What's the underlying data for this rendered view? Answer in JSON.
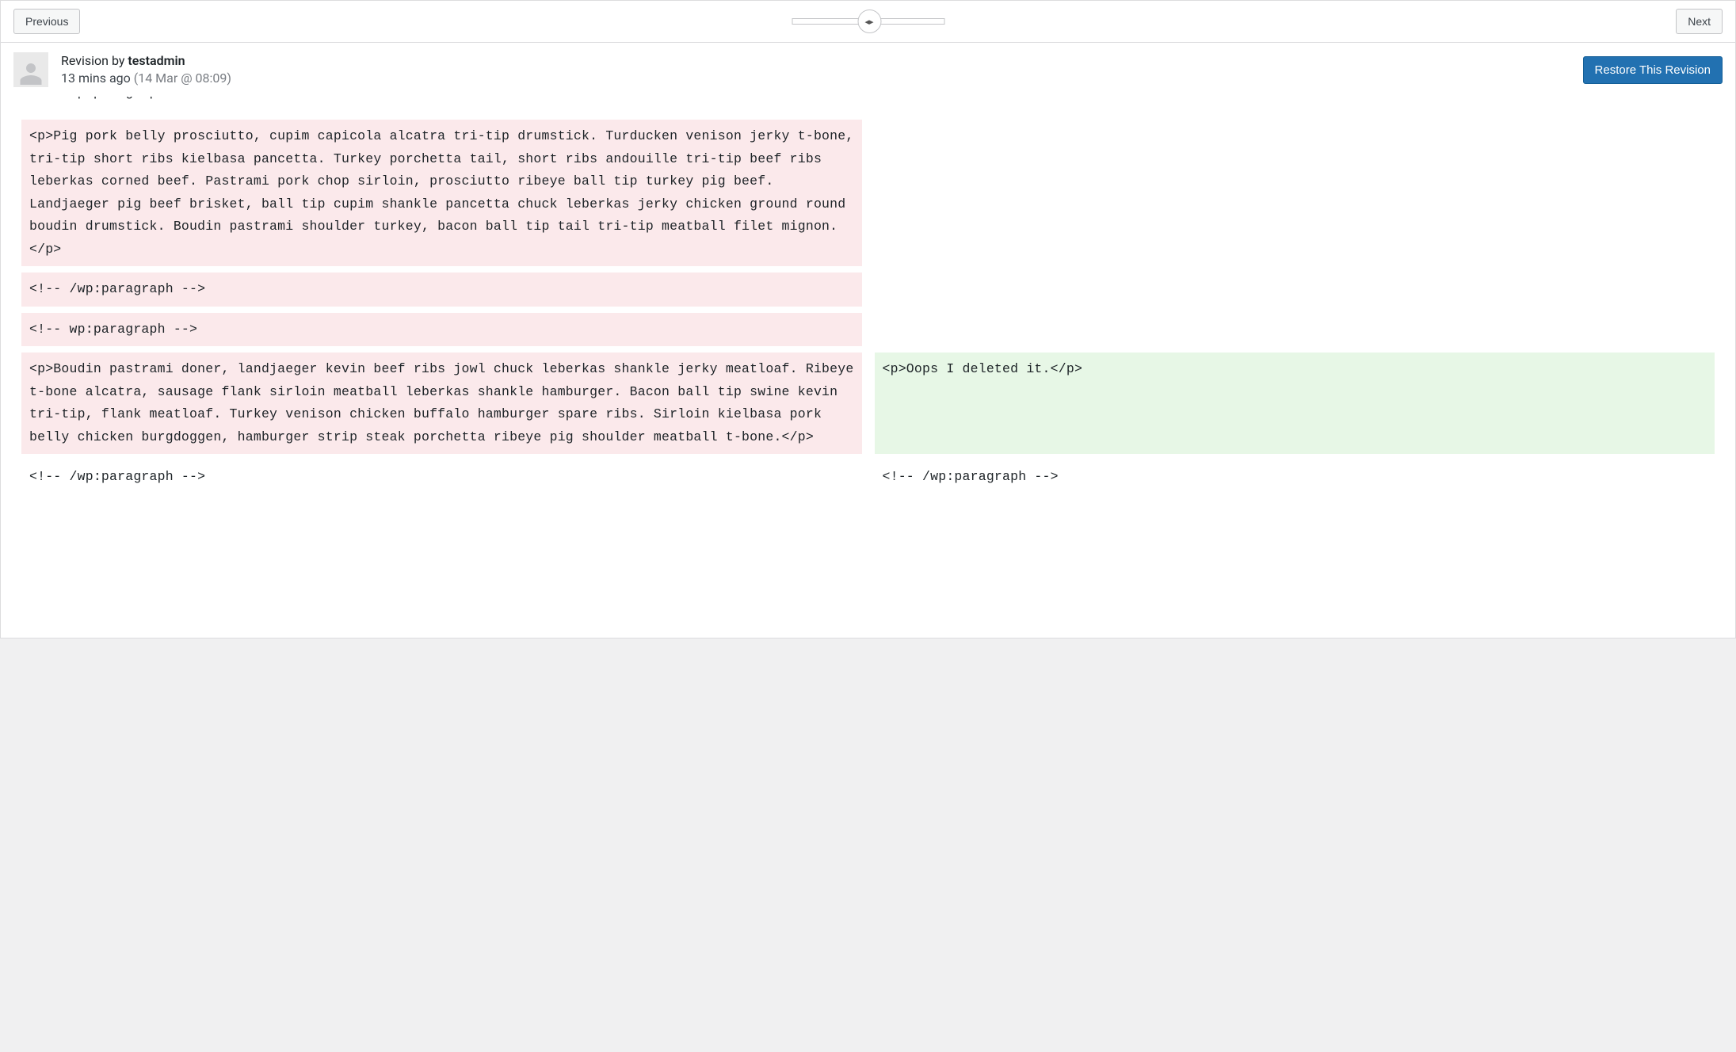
{
  "header": {
    "previous_label": "Previous",
    "next_label": "Next",
    "slider_handle_glyph": "◂▸"
  },
  "meta": {
    "revision_by_label": "Revision by ",
    "username": "testadmin",
    "time_relative": "13 mins ago ",
    "time_absolute": "(14 Mar @ 08:09)",
    "restore_label": "Restore This Revision"
  },
  "diff": {
    "rows": [
      {
        "left": "<!-- wp:paragraph -->",
        "left_class": "removed",
        "right": "",
        "right_class": "empty",
        "partial": true
      },
      {
        "left": "<p>Pig pork belly prosciutto, cupim capicola alcatra tri-tip drumstick. Turducken venison jerky t-bone, tri-tip short ribs kielbasa pancetta. Turkey porchetta tail, short ribs andouille tri-tip beef ribs leberkas corned beef. Pastrami pork chop sirloin, prosciutto ribeye ball tip turkey pig beef. Landjaeger pig beef brisket, ball tip cupim shankle pancetta chuck leberkas jerky chicken ground round boudin drumstick. Boudin pastrami shoulder turkey, bacon ball tip tail tri-tip meatball filet mignon.</p>",
        "left_class": "removed",
        "right": "",
        "right_class": "empty"
      },
      {
        "left": "<!-- /wp:paragraph -->",
        "left_class": "removed",
        "right": "",
        "right_class": "empty"
      },
      {
        "left": "<!-- wp:paragraph -->",
        "left_class": "removed",
        "right": "",
        "right_class": "empty"
      },
      {
        "left": "<p>Boudin pastrami doner, landjaeger kevin beef ribs jowl chuck leberkas shankle jerky meatloaf. Ribeye t-bone alcatra, sausage flank sirloin meatball leberkas shankle hamburger. Bacon ball tip swine kevin tri-tip, flank meatloaf. Turkey venison chicken buffalo hamburger spare ribs. Sirloin kielbasa pork belly chicken burgdoggen, hamburger strip steak porchetta ribeye pig shoulder meatball t-bone.</p>",
        "left_class": "removed",
        "right": "<p>Oops I deleted it.</p>",
        "right_class": "added"
      },
      {
        "left": "<!-- /wp:paragraph -->",
        "left_class": "unchanged",
        "right": "<!-- /wp:paragraph -->",
        "right_class": "unchanged"
      }
    ]
  }
}
